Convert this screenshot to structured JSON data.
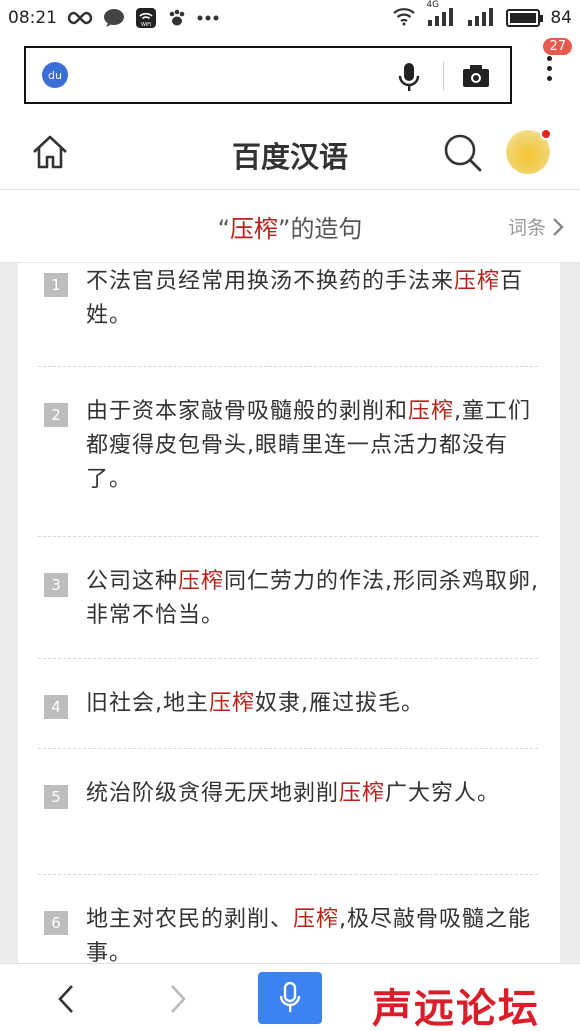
{
  "status_bar": {
    "time": "08:21",
    "network": "4G",
    "battery": "84",
    "wifi_label": "WiFi"
  },
  "address_bar": {
    "logo_text": "du",
    "tab_count": "27"
  },
  "header": {
    "title": "百度汉语"
  },
  "subheader": {
    "quote_open": "“",
    "keyword": "压榨",
    "quote_close": "”",
    "suffix": "的造句",
    "entry_link": "词条"
  },
  "sentences": [
    {
      "num": "1",
      "pre": "不法官员经常用换汤不换药的手法来",
      "kw": "压榨",
      "post": "百姓。"
    },
    {
      "num": "2",
      "pre": "由于资本家敲骨吸髓般的剥削和",
      "kw": "压榨",
      "post": ",童工们都瘦得皮包骨头,眼睛里连一点活力都没有了。"
    },
    {
      "num": "3",
      "pre": "公司这种",
      "kw": "压榨",
      "post": "同仁劳力的作法,形同杀鸡取卵,非常不恰当。"
    },
    {
      "num": "4",
      "pre": "旧社会,地主",
      "kw": "压榨",
      "post": "奴隶,雁过拔毛。"
    },
    {
      "num": "5",
      "pre": "统治阶级贪得无厌地剥削",
      "kw": "压榨",
      "post": "广大穷人。"
    },
    {
      "num": "6",
      "pre": "地主对农民的剥削、",
      "kw": "压榨",
      "post": ",极尽敲骨吸髓之能事。"
    }
  ],
  "watermark": "声远论坛",
  "colors": {
    "accent": "#b5231b",
    "voice_button": "#3c82f0",
    "badge": "#e85a4f"
  }
}
